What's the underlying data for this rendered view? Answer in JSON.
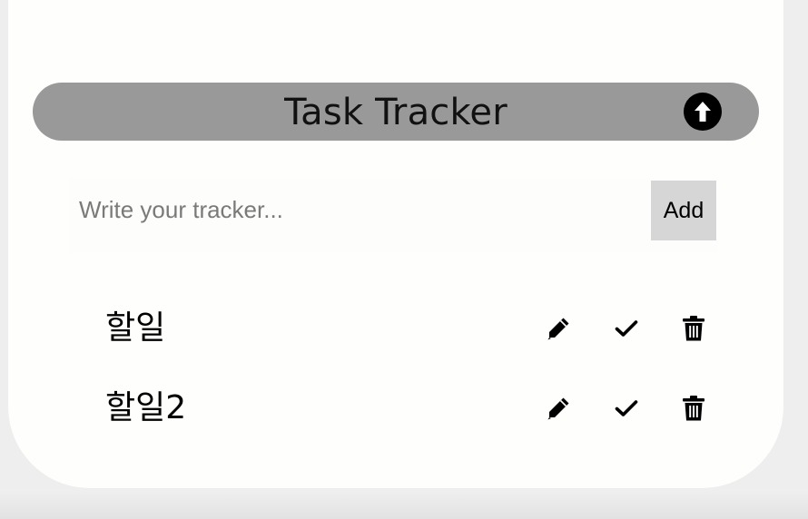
{
  "header": {
    "title": "Task Tracker",
    "collapse_icon": "arrow-up-circle-icon"
  },
  "composer": {
    "placeholder": "Write your tracker...",
    "value": "",
    "add_label": "Add"
  },
  "tasks": [
    {
      "label": "할일",
      "icons": [
        "pencil-icon",
        "check-icon",
        "trash-icon"
      ]
    },
    {
      "label": "할일2",
      "icons": [
        "pencil-icon",
        "check-icon",
        "trash-icon"
      ]
    }
  ],
  "colors": {
    "header_bg": "#999999",
    "add_button_bg": "#d6d6d6",
    "card_bg": "#fefefd",
    "page_bg": "#eeeeee"
  }
}
